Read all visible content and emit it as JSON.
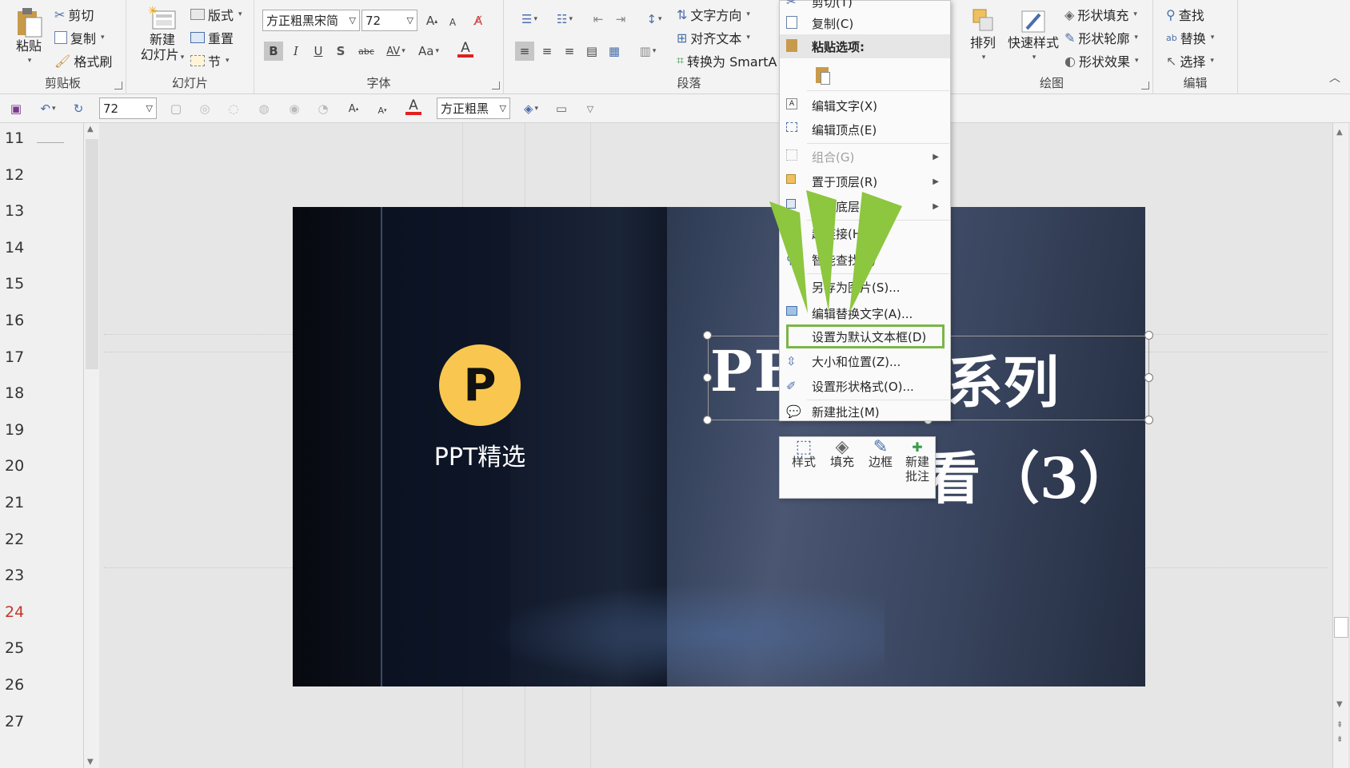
{
  "ribbon": {
    "clipboard": {
      "paste": "粘贴",
      "cut": "剪切",
      "copy": "复制",
      "format_painter": "格式刷",
      "label": "剪贴板"
    },
    "slides": {
      "new_slide_line1": "新建",
      "new_slide_line2": "幻灯片",
      "layout": "版式",
      "reset": "重置",
      "section": "节",
      "label": "幻灯片"
    },
    "font": {
      "font_name": "方正粗黑宋简",
      "font_size": "72",
      "bold": "B",
      "italic": "I",
      "underline": "U",
      "shadow": "S",
      "strike": "abc",
      "spacing": "AV",
      "case": "Aa",
      "font_color_letter": "A",
      "grow": "A",
      "shrink": "A",
      "label": "字体"
    },
    "paragraph": {
      "text_direction": "文字方向",
      "align_text": "对齐文本",
      "convert_smartart": "转换为 SmartA",
      "label": "段落"
    },
    "drawing": {
      "arrange": "排列",
      "quick_styles": "快速样式",
      "shape_fill": "形状填充",
      "shape_outline": "形状轮廓",
      "shape_effects": "形状效果",
      "label": "绘图"
    },
    "editing": {
      "find": "查找",
      "replace": "替换",
      "select": "选择",
      "label": "编辑"
    }
  },
  "qat": {
    "font_size": "72",
    "font_name": "方正粗黑",
    "font_color_letter": "A"
  },
  "outline_numbers": [
    "11",
    "12",
    "13",
    "14",
    "15",
    "16",
    "17",
    "18",
    "19",
    "20",
    "21",
    "22",
    "23",
    "24",
    "25",
    "26",
    "27"
  ],
  "current_line": "24",
  "slide": {
    "logo_letter": "P",
    "logo_caption": "PPT精选",
    "title_line1_left": "PE",
    "title_line1_right": "系列",
    "title_line2_right": "（3）",
    "title_line2_partial": "看"
  },
  "context_menu": {
    "items": [
      {
        "label": "剪切(T)"
      },
      {
        "label": "复制(C)"
      },
      {
        "label": "粘贴选项:"
      },
      {
        "label": "编辑文字(X)"
      },
      {
        "label": "编辑顶点(E)"
      },
      {
        "label": "组合(G)"
      },
      {
        "label": "置于顶层(R)"
      },
      {
        "label": "置于底层(K)"
      },
      {
        "label": "超链接(H)..."
      },
      {
        "label": "智能查找(L)"
      },
      {
        "label": "另存为图片(S)..."
      },
      {
        "label": "编辑替换文字(A)..."
      },
      {
        "label": "设置为默认文本框(D)"
      },
      {
        "label": "大小和位置(Z)..."
      },
      {
        "label": "设置形状格式(O)..."
      },
      {
        "label": "新建批注(M)"
      }
    ]
  },
  "mini_toolbar": {
    "style": "样式",
    "fill": "填充",
    "border": "边框",
    "new_comment_line1": "新建",
    "new_comment_line2": "批注"
  },
  "colors": {
    "accent_green": "#8dc63f",
    "highlight_border": "#7ab648",
    "logo_yellow": "#f9c74f",
    "font_red": "#e02020",
    "current_line_red": "#c0392b"
  }
}
